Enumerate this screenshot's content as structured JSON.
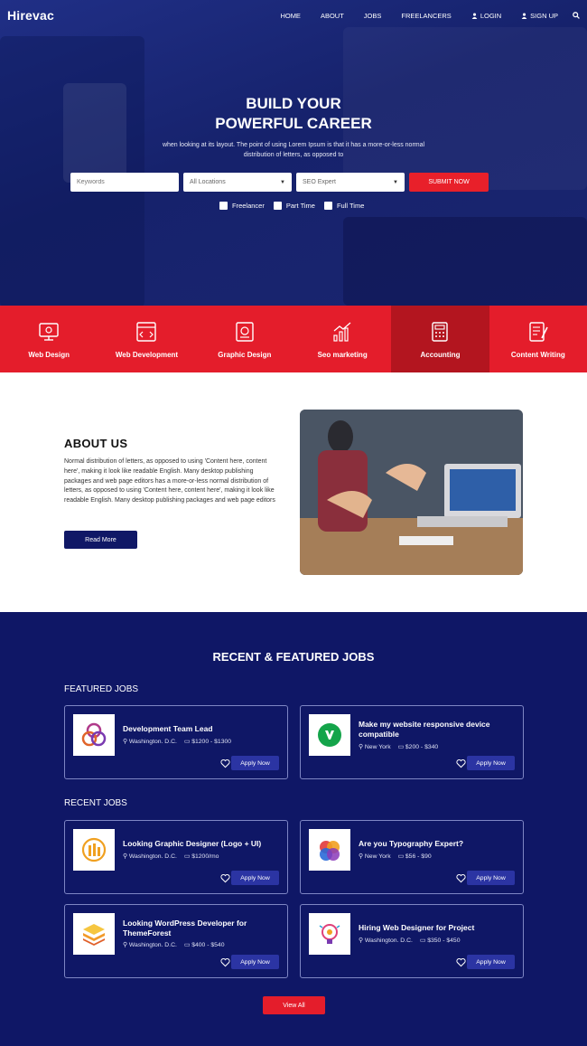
{
  "nav": {
    "brand": "Hirevac",
    "items": [
      "HOME",
      "ABOUT",
      "JOBS",
      "FREELANCERS"
    ],
    "login": "LOGIN",
    "signup": "SIGN UP"
  },
  "hero": {
    "title_line1": "BUILD YOUR",
    "title_line2": "POWERFUL CAREER",
    "subtitle": "when looking at its layout. The point of using Lorem Ipsum is that it has a more-or-less normal distribution of letters, as opposed to",
    "keywords_placeholder": "Keywords",
    "location_value": "All Locations",
    "category_value": "SEO Expert",
    "submit_label": "SUBMIT NOW",
    "checkboxes": [
      "Freelancer",
      "Part Time",
      "Full Time"
    ]
  },
  "categories": [
    {
      "label": "Web Design",
      "icon": "monitor-icon"
    },
    {
      "label": "Web Development",
      "icon": "code-window-icon"
    },
    {
      "label": "Graphic Design",
      "icon": "design-tools-icon"
    },
    {
      "label": "Seo marketing",
      "icon": "growth-chart-icon"
    },
    {
      "label": "Accounting",
      "icon": "calculator-icon"
    },
    {
      "label": "Content Writing",
      "icon": "document-pen-icon"
    }
  ],
  "about": {
    "title": "ABOUT US",
    "text": "Normal distribution of letters, as opposed to using 'Content here, content here', making it look like readable English. Many desktop publishing packages and web page editors has a more-or-less normal distribution of letters, as opposed to using 'Content here, content here', making it look like readable English. Many desktop publishing packages and web page editors",
    "button": "Read More"
  },
  "jobs": {
    "title": "RECENT & FEATURED JOBS",
    "featured_label": "FEATURED JOBS",
    "recent_label": "RECENT JOBS",
    "apply_label": "Apply Now",
    "view_all": "View All",
    "featured": [
      {
        "title": "Development Team Lead",
        "location": "Washington. D.C.",
        "salary": "$1200 - $1300",
        "logo": "triple-ring-logo"
      },
      {
        "title": "Make my website responsive device compatible",
        "location": "New York",
        "salary": "$200 - $340",
        "logo": "green-upwork-logo"
      }
    ],
    "recent": [
      {
        "title": "Looking Graphic Designer (Logo + UI)",
        "location": "Washington. D.C.",
        "salary": "$1200/mo",
        "logo": "orange-bars-logo"
      },
      {
        "title": "Are you Typography Expert?",
        "location": "New York",
        "salary": "$56 - $90",
        "logo": "color-circles-logo"
      },
      {
        "title": "Looking WordPress Developer for ThemeForest",
        "location": "Washington. D.C.",
        "salary": "$400 - $540",
        "logo": "layers-logo"
      },
      {
        "title": "Hiring Web Designer for Project",
        "location": "Washington. D.C.",
        "salary": "$350 - $450",
        "logo": "lightbulb-logo"
      }
    ]
  }
}
